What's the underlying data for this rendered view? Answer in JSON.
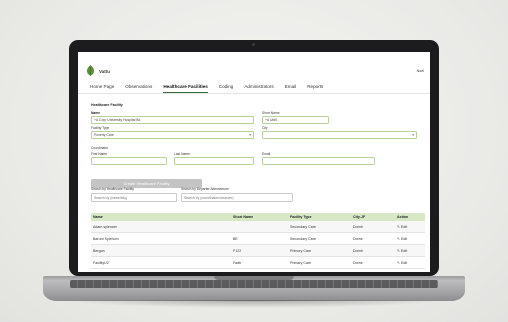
{
  "app": {
    "brand": "Vattu",
    "user": "Noel"
  },
  "nav": {
    "items": [
      "Home Page",
      "Observations",
      "Healthcare Facilities",
      "Coding",
      "Administrators",
      "Email",
      "Reports"
    ],
    "active": "Healthcare Facilities"
  },
  "form": {
    "section_title": "Healthcare Facility",
    "name_label": "Name",
    "name_value": "+A Corp University Hospital Bk",
    "short_name_label": "Short Name",
    "short_name_value": "+A Ukt5",
    "facility_type_label": "Facility Type",
    "facility_type_value": "Poverty Care",
    "city_label": "City",
    "city_value": "",
    "coordinator_title": "Coordinator",
    "first_name_label": "First Name",
    "last_name_label": "Last Name",
    "email_label": "Email",
    "create_button": "Create Healthcare Facility"
  },
  "search": {
    "facility_label": "Search by Healthcare Facility",
    "facility_placeholder": "Search by (name/bity)",
    "coordinator_label": "Search by Departer Administrum",
    "coordinator_placeholder": "Search by (coordinator/observer)"
  },
  "table": {
    "headers": [
      "Name",
      "Short Name",
      "Facility Type",
      "City-JF",
      "Action"
    ],
    "rows": [
      [
        "Adam sylenam",
        "",
        "Secondary Care",
        "Dornti",
        "Edit"
      ],
      [
        "Barunt Sylehom",
        "BE",
        "Secondary Care",
        "Dorne",
        "Edit"
      ],
      [
        "Bergon",
        "F122",
        "Primory Care",
        "Dornti",
        "Edit"
      ],
      [
        "FacilityU2",
        "Fadb",
        "Primary Care",
        "Dorne",
        "Edit"
      ]
    ]
  },
  "colors": {
    "brand_green": "#5b8f3a",
    "header_green": "#d7e8c5",
    "field_border": "#b6d39a"
  }
}
